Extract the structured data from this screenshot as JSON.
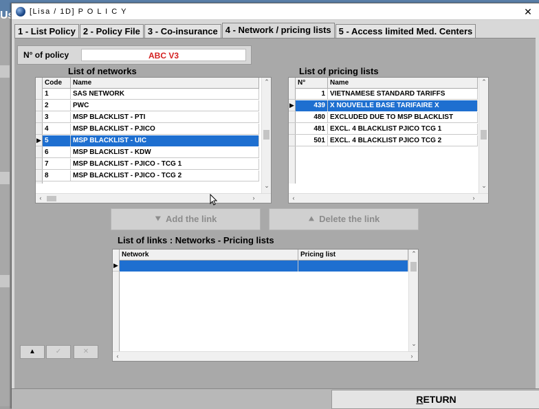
{
  "window": {
    "title": "[Lisa / 1D] P O L I C Y",
    "close_symbol": "✕"
  },
  "background_app": {
    "partial_text": "Us"
  },
  "tabs": [
    {
      "label": "1 - List Policy",
      "active": false
    },
    {
      "label": "2 - Policy File",
      "active": false
    },
    {
      "label": "3 - Co-insurance",
      "active": false
    },
    {
      "label": "4 - Network / pricing lists",
      "active": true
    },
    {
      "label": "5 - Access limited Med. Centers",
      "active": false
    }
  ],
  "policy": {
    "label": "N° of policy",
    "value": "ABC V3",
    "value_color": "#d42020"
  },
  "networks": {
    "title": "List of networks",
    "columns": [
      "Code",
      "Name"
    ],
    "rows": [
      {
        "code": "1",
        "name": "SAS NETWORK"
      },
      {
        "code": "2",
        "name": "PWC"
      },
      {
        "code": "3",
        "name": "MSP BLACKLIST - PTI"
      },
      {
        "code": "4",
        "name": "MSP BLACKLIST - PJICO"
      },
      {
        "code": "5",
        "name": "MSP BLACKLIST - UIC"
      },
      {
        "code": "6",
        "name": "MSP BLACKLIST - KDW"
      },
      {
        "code": "7",
        "name": "MSP BLACKLIST - PJICO - TCG 1"
      },
      {
        "code": "8",
        "name": "MSP BLACKLIST - PJICO - TCG 2"
      }
    ],
    "selected_index": 4
  },
  "pricing_lists": {
    "title": "List of pricing lists",
    "columns": [
      "N°",
      "Name"
    ],
    "rows": [
      {
        "no": "1",
        "name": "VIETNAMESE STANDARD TARIFFS"
      },
      {
        "no": "439",
        "name": "X NOUVELLE BASE TARIFAIRE X"
      },
      {
        "no": "480",
        "name": "EXCLUDED DUE TO MSP BLACKLIST"
      },
      {
        "no": "481",
        "name": "EXCL. 4 BLACKLIST PJICO TCG 1"
      },
      {
        "no": "501",
        "name": "EXCL. 4 BLACKLIST PJICO TCG 2"
      }
    ],
    "selected_index": 1
  },
  "actions": {
    "add_label": "Add the link",
    "add_icon": "⯆",
    "delete_label": "Delete the link",
    "delete_icon": "⯅"
  },
  "links": {
    "title": "List of links : Networks - Pricing lists",
    "columns": [
      "Network",
      "Pricing list"
    ]
  },
  "nav_buttons": {
    "up": "▲",
    "check": "✓",
    "cancel": "✕"
  },
  "return": {
    "first_letter": "R",
    "rest": "ETURN"
  },
  "colors": {
    "selection": "#1e6fd0",
    "panel": "#a9a9a9"
  }
}
